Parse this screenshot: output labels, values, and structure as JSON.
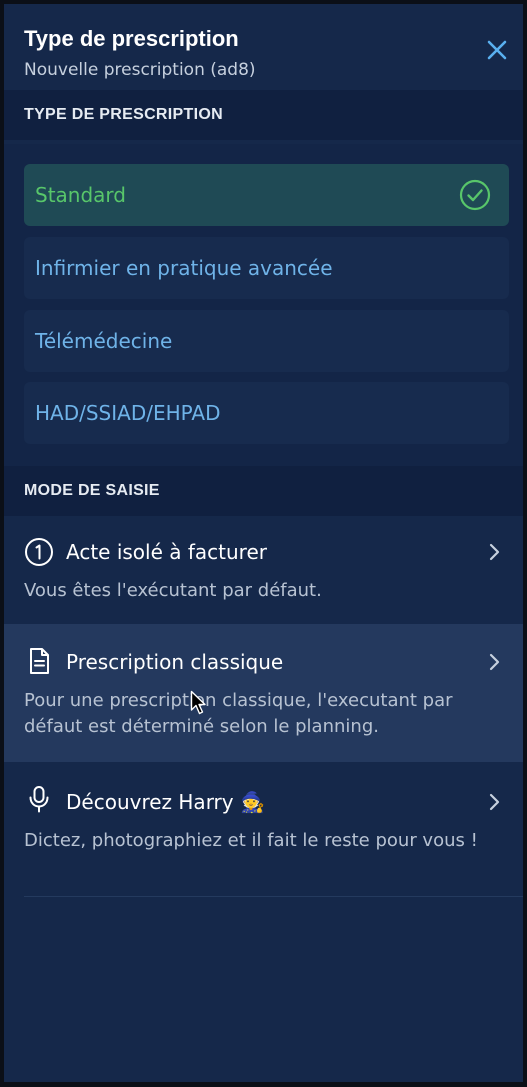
{
  "header": {
    "title": "Type de prescription",
    "subtitle": "Nouvelle prescription (ad8)",
    "close_icon": "close-icon"
  },
  "type_section": {
    "heading": "TYPE DE PRESCRIPTION",
    "options": [
      {
        "label": "Standard",
        "selected": true
      },
      {
        "label": "Infirmier en pratique avancée",
        "selected": false
      },
      {
        "label": "Télémédecine",
        "selected": false
      },
      {
        "label": "HAD/SSIAD/EHPAD",
        "selected": false
      }
    ]
  },
  "mode_section": {
    "heading": "MODE DE SAISIE",
    "items": [
      {
        "title": "Acte isolé à facturer",
        "description": "Vous êtes l'exécutant par défaut.",
        "icon": "number-one-circle-icon"
      },
      {
        "title": "Prescription classique",
        "description": "Pour une prescription classique, l'executant par défaut est déterminé selon le planning.",
        "icon": "document-icon"
      },
      {
        "title": "Découvrez Harry 🧙",
        "description": "Dictez, photographiez et il fait le reste pour vous !",
        "icon": "microphone-icon"
      }
    ]
  },
  "colors": {
    "panel_bg": "#15284a",
    "section_bg": "#102040",
    "selected_bg": "#1f4a55",
    "selected_text": "#58c66a",
    "link_text": "#6fb3e8",
    "close_accent": "#5ab0f0"
  }
}
